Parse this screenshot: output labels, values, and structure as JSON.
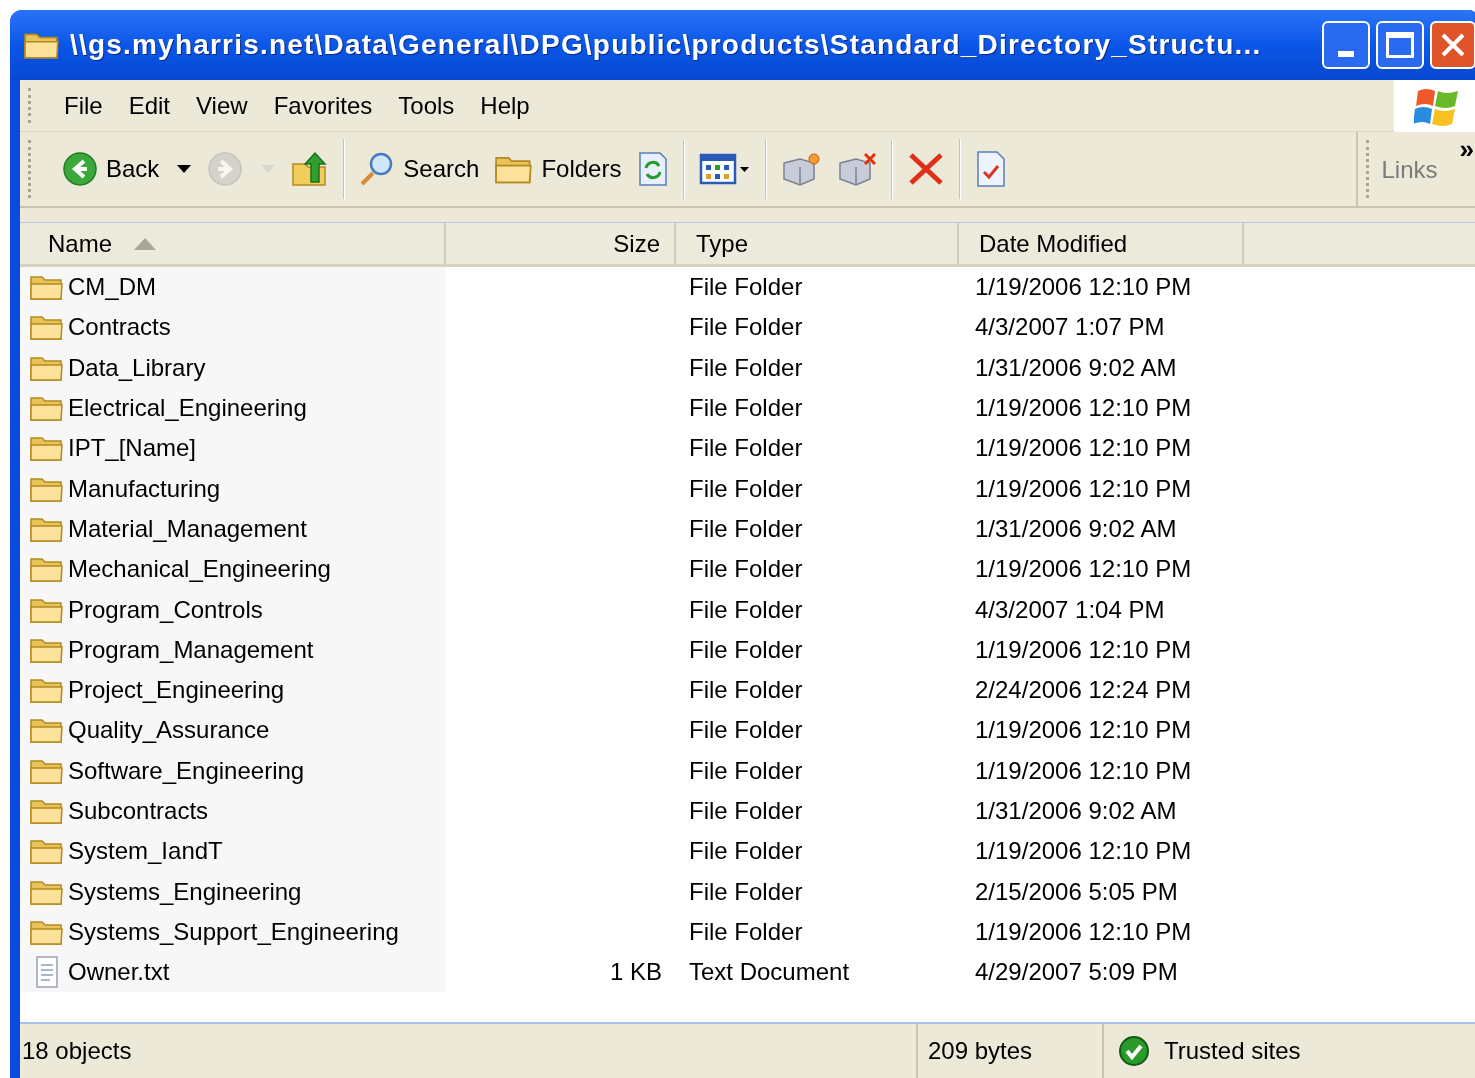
{
  "window": {
    "title": "\\\\gs.myharris.net\\Data\\General\\DPG\\public\\products\\Standard_Directory_Structu..."
  },
  "menu": [
    "File",
    "Edit",
    "View",
    "Favorites",
    "Tools",
    "Help"
  ],
  "toolbar": [
    {
      "kind": "back",
      "label": "Back",
      "disabled": false
    },
    {
      "kind": "forward",
      "disabled": true
    },
    {
      "kind": "up",
      "disabled": false
    },
    {
      "kind": "search",
      "label": "Search",
      "disabled": false
    },
    {
      "kind": "folders",
      "label": "Folders",
      "disabled": false
    },
    {
      "kind": "sync",
      "disabled": false
    },
    {
      "kind": "views",
      "disabled": false
    },
    {
      "kind": "move",
      "disabled": false
    },
    {
      "kind": "copy",
      "disabled": false
    },
    {
      "kind": "delete",
      "disabled": false
    },
    {
      "kind": "properties",
      "disabled": false
    }
  ],
  "links": {
    "label": "Links",
    "more": "»"
  },
  "table": {
    "columns": [
      {
        "label": "Name",
        "sorted": true
      },
      {
        "label": "Size",
        "sorted": false
      },
      {
        "label": "Type",
        "sorted": false
      },
      {
        "label": "Date Modified",
        "sorted": false
      }
    ],
    "rows": [
      {
        "kind": "folder",
        "name": "CM_DM",
        "size": "",
        "type": "File Folder",
        "date": "1/19/2006 12:10 PM"
      },
      {
        "kind": "folder",
        "name": "Contracts",
        "type": "File Folder",
        "date": "4/3/2007 1:07 PM"
      },
      {
        "kind": "folder",
        "name": "Data_Library",
        "type": "File Folder",
        "date": "1/31/2006 9:02 AM"
      },
      {
        "kind": "folder",
        "name": "Electrical_Engineering",
        "type": "File Folder",
        "date": "1/19/2006 12:10 PM"
      },
      {
        "kind": "folder",
        "name": "IPT_[Name]",
        "type": "File Folder",
        "date": "1/19/2006 12:10 PM"
      },
      {
        "kind": "folder",
        "name": "Manufacturing",
        "type": "File Folder",
        "date": "1/19/2006 12:10 PM"
      },
      {
        "kind": "folder",
        "name": "Material_Management",
        "type": "File Folder",
        "date": "1/31/2006 9:02 AM"
      },
      {
        "kind": "folder",
        "name": "Mechanical_Engineering",
        "type": "File Folder",
        "date": "1/19/2006 12:10 PM"
      },
      {
        "kind": "folder",
        "name": "Program_Controls",
        "type": "File Folder",
        "date": "4/3/2007 1:04 PM"
      },
      {
        "kind": "folder",
        "name": "Program_Management",
        "type": "File Folder",
        "date": "1/19/2006 12:10 PM"
      },
      {
        "kind": "folder",
        "name": "Project_Engineering",
        "type": "File Folder",
        "date": "2/24/2006 12:24 PM"
      },
      {
        "kind": "folder",
        "name": "Quality_Assurance",
        "type": "File Folder",
        "date": "1/19/2006 12:10 PM"
      },
      {
        "kind": "folder",
        "name": "Software_Engineering",
        "type": "File Folder",
        "date": "1/19/2006 12:10 PM"
      },
      {
        "kind": "folder",
        "name": "Subcontracts",
        "type": "File Folder",
        "date": "1/31/2006 9:02 AM"
      },
      {
        "kind": "folder",
        "name": "System_IandT",
        "type": "File Folder",
        "date": "1/19/2006 12:10 PM"
      },
      {
        "kind": "folder",
        "name": "Systems_Engineering",
        "type": "File Folder",
        "date": "2/15/2006 5:05 PM"
      },
      {
        "kind": "folder",
        "name": "Systems_Support_Engineering",
        "type": "File Folder",
        "date": "1/19/2006 12:10 PM"
      },
      {
        "kind": "file",
        "name": "Owner.txt",
        "size": "1 KB",
        "type": "Text Document",
        "date": "4/29/2007 5:09 PM"
      }
    ]
  },
  "status_bar": {
    "objects": "18 objects",
    "size": "209 bytes",
    "zone": "Trusted sites"
  }
}
